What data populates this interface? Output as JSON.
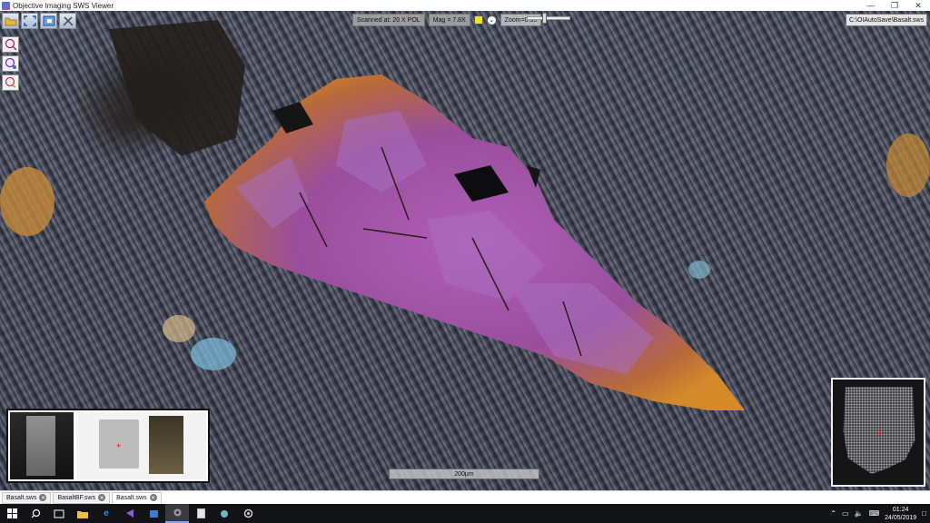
{
  "window": {
    "title": "Objective Imaging SWS Viewer"
  },
  "status": {
    "scan": "Scanned at: 20 X POL",
    "mag": "Mag = 7.8X",
    "zoom": "Zoom=0.39",
    "zoom_slider_fraction": 0.4,
    "marker_color": "#e6e62a",
    "file_path": "C:\\OIAutoSave\\Basalt.sws"
  },
  "scale_bar": {
    "label": "200µm"
  },
  "tabs": [
    {
      "label": "Basalt.sws",
      "active": false
    },
    {
      "label": "BasaltBF.sws",
      "active": false
    },
    {
      "label": "Basalt.sws",
      "active": true
    }
  ],
  "taskbar": {
    "time": "01:24",
    "date": "24/05/2019"
  },
  "icons": {
    "toolbar": [
      "open-folder-icon",
      "fit-screen-icon",
      "overview-icon",
      "tools-icon"
    ],
    "side": [
      "annotate-icon",
      "measure-icon",
      "layers-icon"
    ]
  }
}
